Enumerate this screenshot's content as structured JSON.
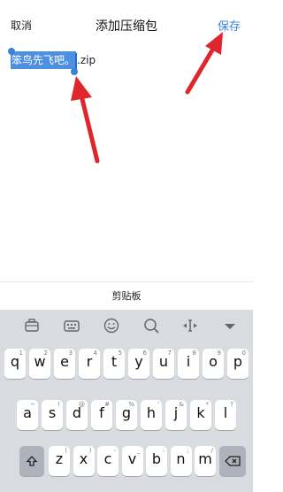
{
  "header": {
    "cancel_label": "取消",
    "title": "添加压缩包",
    "save_label": "保存"
  },
  "filename": {
    "selected_text": "笨鸟先飞吧。",
    "extension": ".zip"
  },
  "clipboard": {
    "label": "剪贴板"
  },
  "keyboard": {
    "toolbar_icons": [
      "toolbox-icon",
      "keyboard-icon",
      "emoji-icon",
      "search-icon",
      "cursor-move-icon",
      "collapse-icon"
    ],
    "row1": [
      {
        "key": "q",
        "hint": "1"
      },
      {
        "key": "w",
        "hint": "2"
      },
      {
        "key": "e",
        "hint": "3"
      },
      {
        "key": "r",
        "hint": "4"
      },
      {
        "key": "t",
        "hint": "5"
      },
      {
        "key": "y",
        "hint": "6"
      },
      {
        "key": "u",
        "hint": "7"
      },
      {
        "key": "i",
        "hint": "8"
      },
      {
        "key": "o",
        "hint": "9"
      },
      {
        "key": "p",
        "hint": "0"
      }
    ],
    "row2": [
      {
        "key": "a",
        "hint": "~"
      },
      {
        "key": "s",
        "hint": "!"
      },
      {
        "key": "d",
        "hint": "@"
      },
      {
        "key": "f",
        "hint": "#"
      },
      {
        "key": "g",
        "hint": "%"
      },
      {
        "key": "h",
        "hint": "'"
      },
      {
        "key": "j",
        "hint": "&"
      },
      {
        "key": "k",
        "hint": "*"
      },
      {
        "key": "l",
        "hint": "?"
      }
    ],
    "row3": [
      {
        "key": "z",
        "hint": "("
      },
      {
        "key": "x",
        "hint": ")"
      },
      {
        "key": "c",
        "hint": "-"
      },
      {
        "key": "v",
        "hint": "_"
      },
      {
        "key": "b",
        "hint": ":"
      },
      {
        "key": "n",
        "hint": ";"
      },
      {
        "key": "m",
        "hint": "/"
      }
    ]
  },
  "colors": {
    "accent": "#3b82d8",
    "selection": "#4f8fe0",
    "arrow": "#e0262d",
    "keyboard_bg": "#d8dbe0"
  }
}
